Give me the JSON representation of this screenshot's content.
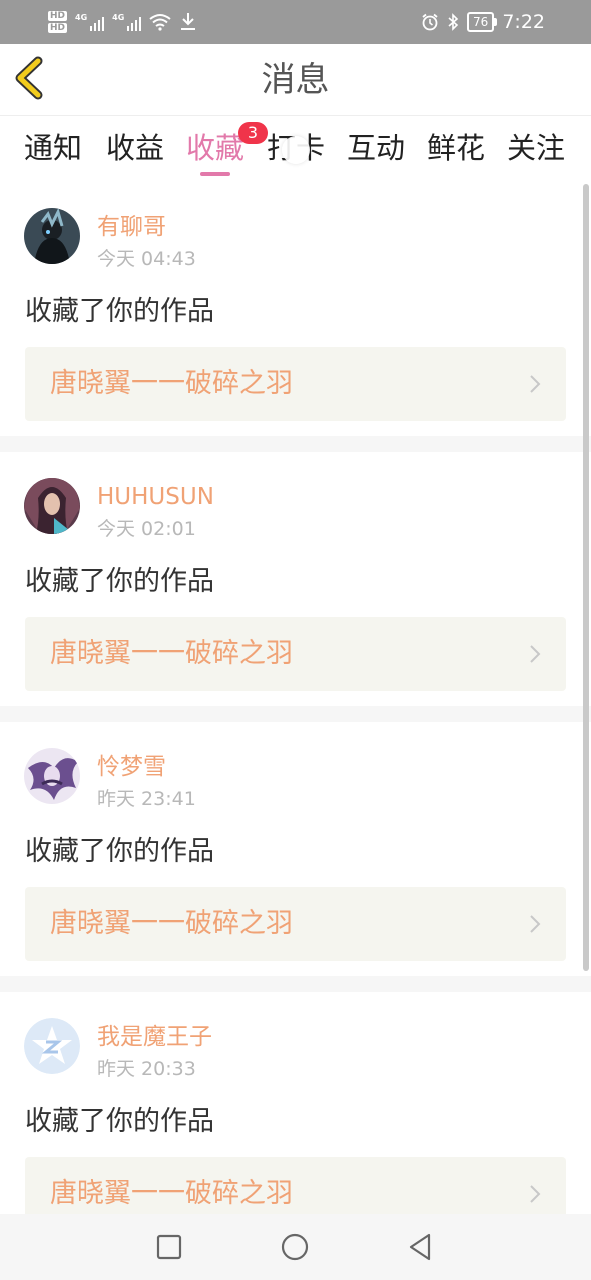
{
  "status_bar": {
    "hd_top": "HD",
    "hd_bottom": "HD",
    "sim1": "4G",
    "sim2": "4G",
    "battery": "76",
    "time": "7:22",
    "icons": [
      "hd-icon",
      "signal-icon",
      "wifi-icon",
      "download-icon",
      "alarm-icon",
      "bluetooth-icon",
      "battery-icon"
    ]
  },
  "header": {
    "title": "消息",
    "back_icon": "chevron-left-icon"
  },
  "tabs": [
    {
      "label": "通知"
    },
    {
      "label": "收益"
    },
    {
      "label": "收藏",
      "active": true,
      "badge": "3"
    },
    {
      "label": "打卡"
    },
    {
      "label": "互动"
    },
    {
      "label": "鲜花"
    },
    {
      "label": "关注"
    }
  ],
  "messages": [
    {
      "username": "有聊哥",
      "time": "今天 04:43",
      "action": "收藏了你的作品",
      "work_title": "唐晓翼一一破碎之羽"
    },
    {
      "username": "HUHUSUN",
      "time": "今天 02:01",
      "action": "收藏了你的作品",
      "work_title": "唐晓翼一一破碎之羽"
    },
    {
      "username": "怜梦雪",
      "time": "昨天 23:41",
      "action": "收藏了你的作品",
      "work_title": "唐晓翼一一破碎之羽"
    },
    {
      "username": "我是魔王子",
      "time": "昨天 20:33",
      "action": "收藏了你的作品",
      "work_title": "唐晓翼一一破碎之羽"
    }
  ],
  "colors": {
    "accent_pink": "#e279aa",
    "username_orange": "#f0a275",
    "badge_red": "#f0344a",
    "back_icon_yellow": "#f2cc1d"
  },
  "system_nav": [
    "recents-square-icon",
    "home-circle-icon",
    "back-triangle-icon"
  ]
}
